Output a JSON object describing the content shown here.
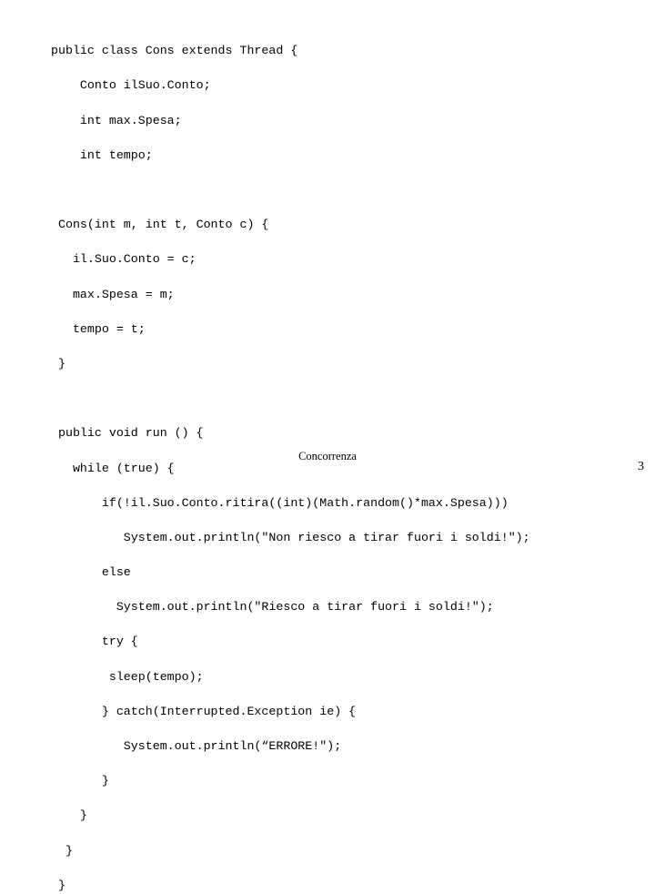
{
  "slide": {
    "background_color": "#ffffff",
    "text_color": "#000000",
    "footer_title": "Concorrenza",
    "page_number": "3",
    "code": {
      "language": "java",
      "lines": [
        "public class Cons extends Thread {",
        "    Conto ilSuo.Conto;",
        "    int max.Spesa;",
        "    int tempo;",
        "",
        " Cons(int m, int t, Conto c) {",
        "   il.Suo.Conto = c;",
        "   max.Spesa = m;",
        "   tempo = t;",
        " }",
        "",
        " public void run () {",
        "   while (true) {",
        "       if(!il.Suo.Conto.ritira((int)(Math.random()*max.Spesa)))",
        "          System.out.println(\"Non riesco a tirar fuori i soldi!\");",
        "       else",
        "         System.out.println(\"Riesco a tirar fuori i soldi!\");",
        "       try {",
        "        sleep(tempo);",
        "       } catch(Interrupted.Exception ie) {",
        "          System.out.println(“ERRORE!\");",
        "       }",
        "    }",
        "  }",
        " }"
      ]
    }
  }
}
